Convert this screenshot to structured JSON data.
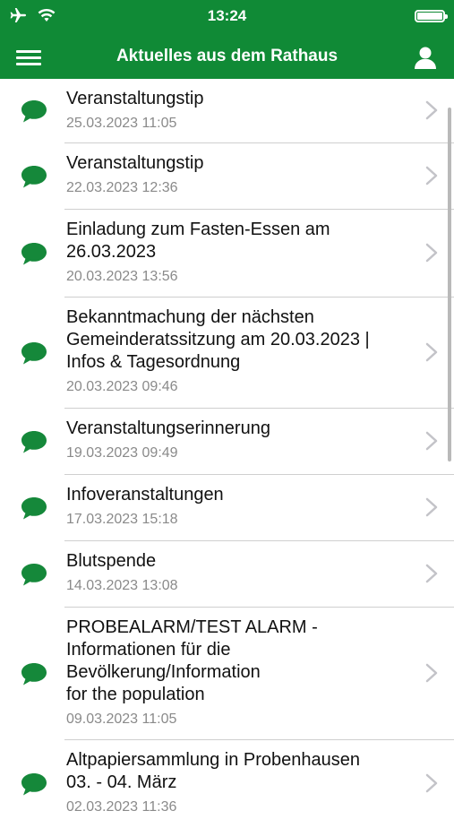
{
  "status_bar": {
    "time": "13:24",
    "icons": [
      "airplane-icon",
      "wifi-icon",
      "battery-icon"
    ]
  },
  "header": {
    "title": "Aktuelles aus dem Rathaus",
    "menu_icon": "hamburger-menu-icon",
    "profile_icon": "user-icon"
  },
  "colors": {
    "brand_green": "#108a36",
    "icon_green": "#15883a",
    "date_gray": "#8a8a8a",
    "chevron_gray": "#c3c3c8"
  },
  "items": [
    {
      "title": "Veranstaltungstip",
      "date": "25.03.2023 11:05"
    },
    {
      "title": "Veranstaltungstip",
      "date": "22.03.2023 12:36"
    },
    {
      "title": "Einladung zum Fasten-Essen am\n26.03.2023",
      "date": "20.03.2023 13:56"
    },
    {
      "title": "Bekanntmachung der nächsten\nGemeinderatssitzung am 20.03.2023 |\nInfos & Tagesordnung",
      "date": "20.03.2023 09:46"
    },
    {
      "title": "Veranstaltungserinnerung",
      "date": "19.03.2023 09:49"
    },
    {
      "title": "Infoveranstaltungen",
      "date": "17.03.2023 15:18"
    },
    {
      "title": "Blutspende",
      "date": "14.03.2023 13:08"
    },
    {
      "title": "PROBEALARM/TEST ALARM -\nInformationen für die\nBevölkerung/Information\nfor the population",
      "date": "09.03.2023 11:05"
    },
    {
      "title": "Altpapiersammlung in Probenhausen\n03. - 04. März",
      "date": "02.03.2023 11:36"
    }
  ]
}
